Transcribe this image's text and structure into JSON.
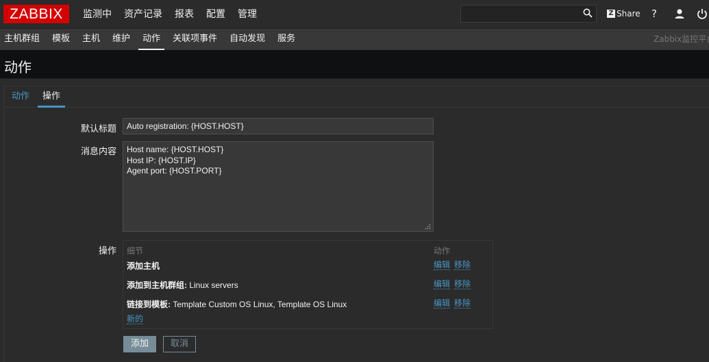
{
  "topnav": {
    "logo": "ZABBIX",
    "menu": [
      "监测中",
      "资产记录",
      "报表",
      "配置",
      "管理"
    ],
    "search_placeholder": "",
    "share_label": "Share",
    "help": "?"
  },
  "subnav": {
    "items": [
      "主机群组",
      "模板",
      "主机",
      "维护",
      "动作",
      "关联项事件",
      "自动发现",
      "服务"
    ],
    "active_index": 4,
    "server_name": "Zabbix监控平台"
  },
  "page": {
    "title": "动作"
  },
  "tabs": [
    "动作",
    "操作"
  ],
  "form": {
    "default_subject_label": "默认标题",
    "default_subject_value": "Auto registration: {HOST.HOST}",
    "message_label": "消息内容",
    "message_value": "Host name: {HOST.HOST}\nHost IP: {HOST.IP}\nAgent port: {HOST.PORT}",
    "operations_label": "操作",
    "operations": {
      "col_details": "细节",
      "col_action": "动作",
      "rows": [
        {
          "bold": "添加主机",
          "text": "",
          "edit": "编辑",
          "remove": "移除"
        },
        {
          "bold": "添加到主机群组:",
          "text": " Linux servers",
          "edit": "编辑",
          "remove": "移除"
        },
        {
          "bold": "链接到模板:",
          "text": " Template Custom OS Linux, Template OS Linux",
          "edit": "编辑",
          "remove": "移除"
        }
      ],
      "new_link": "新的"
    },
    "add_button": "添加",
    "cancel_button": "取消"
  },
  "colors": {
    "accent": "#4796c4",
    "logo": "#d40000",
    "button": "#768d99"
  }
}
